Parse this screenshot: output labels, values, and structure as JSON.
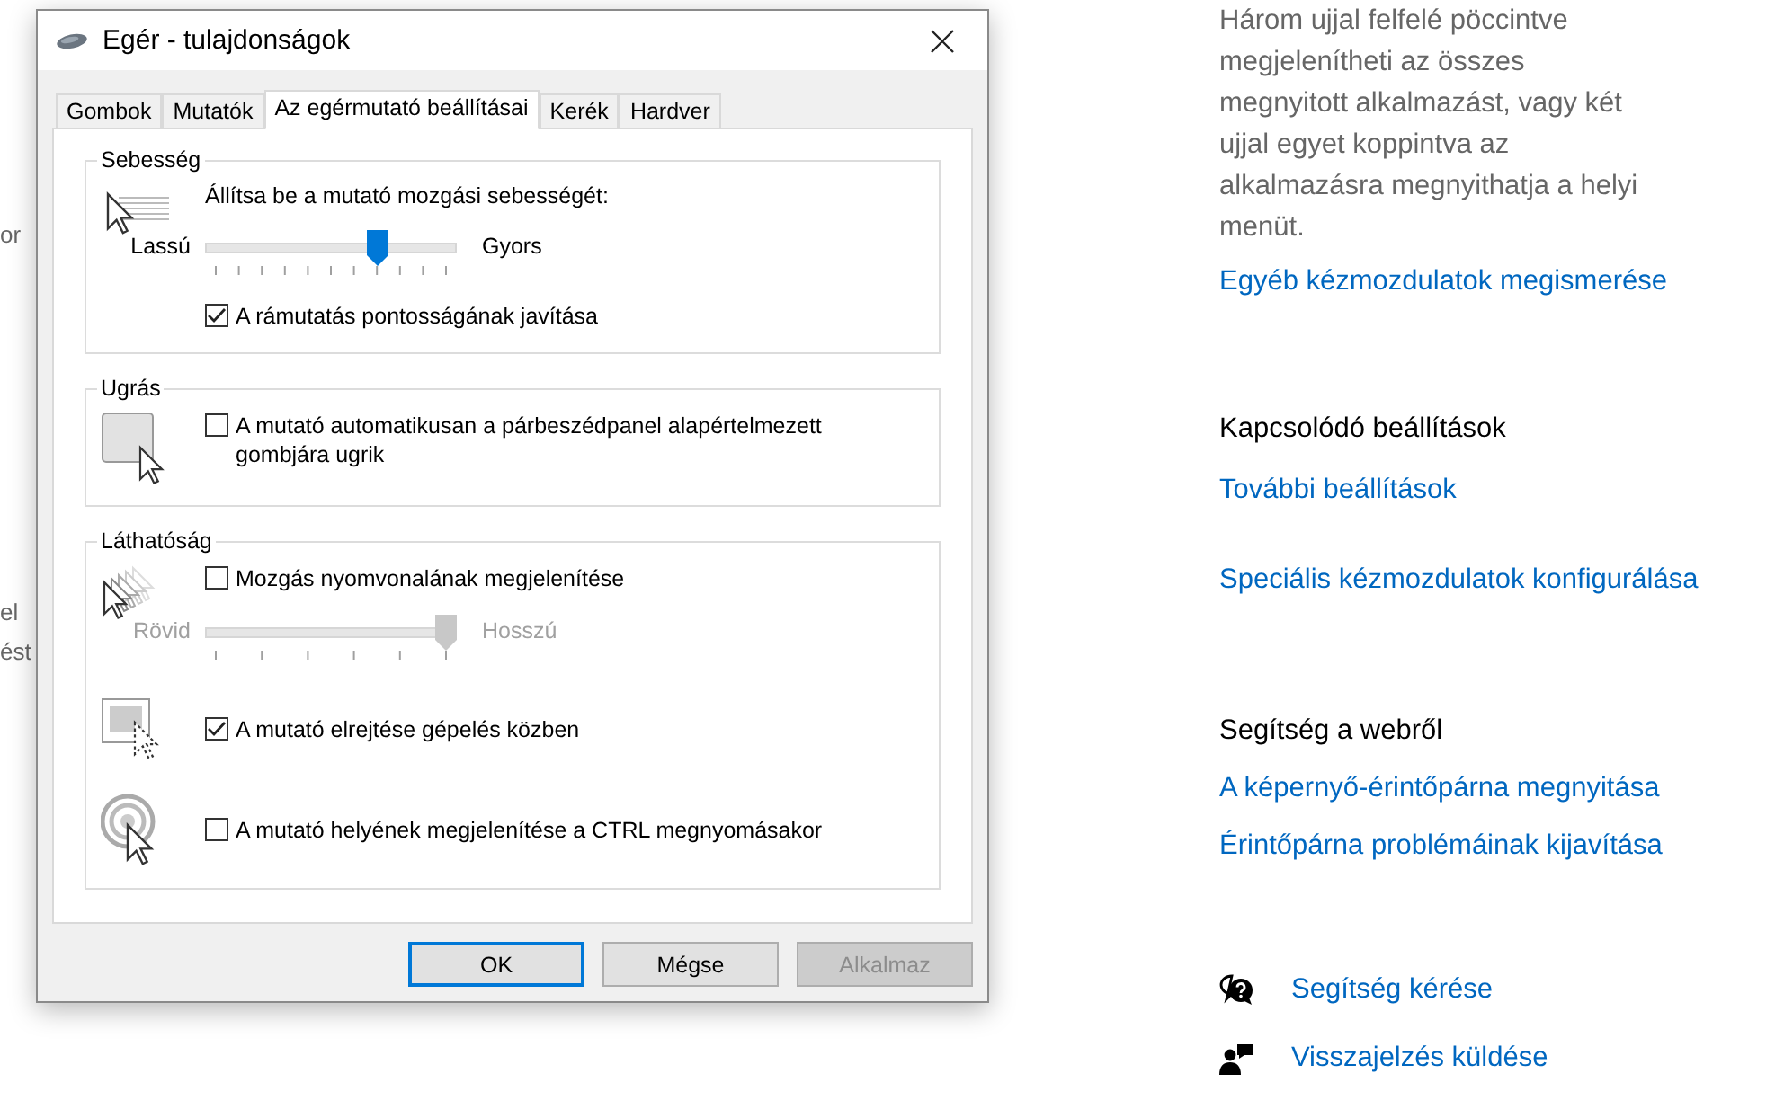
{
  "background_fragments": [
    "or",
    "el",
    "ést"
  ],
  "dialog": {
    "title": "Egér - tulajdonságok",
    "tabs": [
      {
        "label": "Gombok",
        "selected": false
      },
      {
        "label": "Mutatók",
        "selected": false
      },
      {
        "label": "Az egérmutató beállításai",
        "selected": true
      },
      {
        "label": "Kerék",
        "selected": false
      },
      {
        "label": "Hardver",
        "selected": false
      }
    ],
    "groups": [
      {
        "title": "Sebesség",
        "rows": [
          [
            {
              "kind": "label",
              "text": "Állítsa be a mutató mozgási sebességét:"
            },
            {
              "kind": "slider",
              "left": "Lassú",
              "right": "Gyors",
              "level": 0.7,
              "disabled": false
            },
            {
              "kind": "checkbox",
              "label": "A rámutatás pontosságának javítása",
              "checked": true
            }
          ]
        ]
      },
      {
        "title": "Ugrás",
        "rows": [
          [
            {
              "kind": "checkbox",
              "label": "A mutató automatikusan a párbeszédpanel alapértelmezett gombjára ugrik",
              "checked": false
            }
          ]
        ]
      },
      {
        "title": "Láthatóság",
        "rows": [
          [
            {
              "kind": "checkbox",
              "label": "Mozgás nyomvonalának megjelenítése",
              "checked": false
            },
            {
              "kind": "slider",
              "left": "Rövid",
              "right": "Hosszú",
              "level": 1,
              "disabled": true
            }
          ],
          [
            {
              "kind": "checkbox",
              "label": "A mutató elrejtése gépelés közben",
              "checked": true
            }
          ],
          [
            {
              "kind": "checkbox",
              "label": "A mutató helyének megjelenítése a CTRL megnyomásakor",
              "checked": false
            }
          ]
        ]
      }
    ],
    "buttons": [
      {
        "label": "OK",
        "default": true,
        "disabled": false
      },
      {
        "label": "Mégse",
        "default": false,
        "disabled": false
      },
      {
        "label": "Alkalmaz",
        "default": false,
        "disabled": true
      }
    ]
  },
  "settings": {
    "description": "Három ujjal felfelé pöccintve megjelenítheti az összes megnyitott alkalmazást, vagy két ujjal egyet koppintva az alkalmazásra megnyithatja a helyi menüt.",
    "more_link": "Egyéb kézmozdulatok megismerése",
    "sections": [
      {
        "heading": "Kapcsolódó beállítások",
        "links": [
          "További beállítások",
          "Speciális kézmozdulatok konfigurálása"
        ]
      },
      {
        "heading": "Segítség a webről",
        "links": [
          "A képernyő-érintőpárna megnyitása",
          "Érintőpárna problémáinak kijavítása"
        ]
      }
    ],
    "help_links": [
      "Segítség kérése",
      "Visszajelzés küldése"
    ]
  }
}
